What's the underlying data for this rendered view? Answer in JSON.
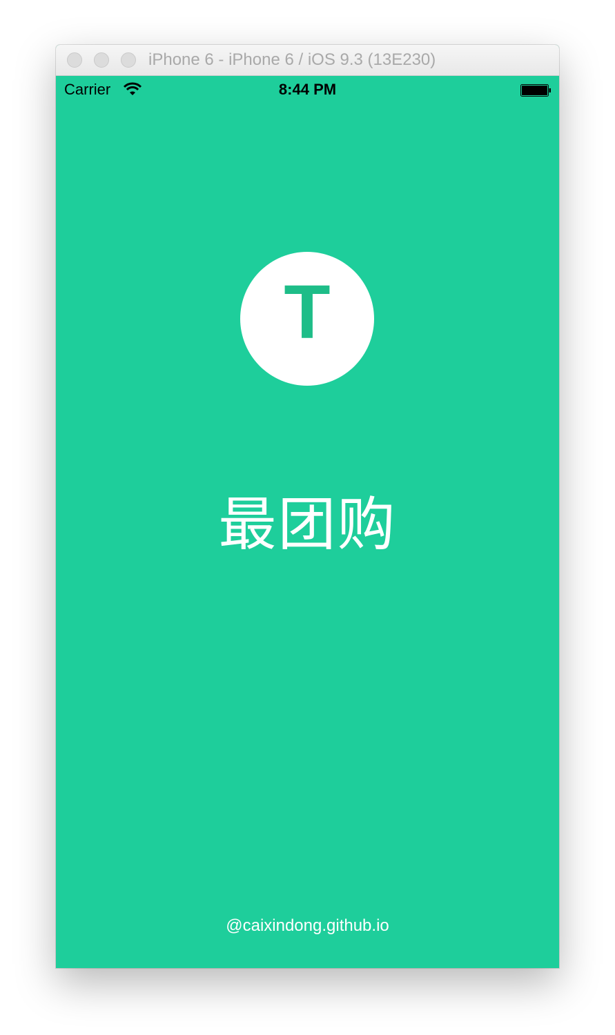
{
  "window": {
    "title": "iPhone 6 - iPhone 6 / iOS 9.3 (13E230)"
  },
  "statusbar": {
    "carrier": "Carrier",
    "time": "8:44 PM",
    "wifi_icon": "wifi-icon",
    "battery_icon": "battery-icon",
    "battery_level": 1.0
  },
  "splash": {
    "logo_letter": "T",
    "app_name": "最团购",
    "footer": "@caixindong.github.io"
  },
  "colors": {
    "background": "#1ece9b",
    "logo_letter": "#1ebd88",
    "text": "#ffffff"
  }
}
